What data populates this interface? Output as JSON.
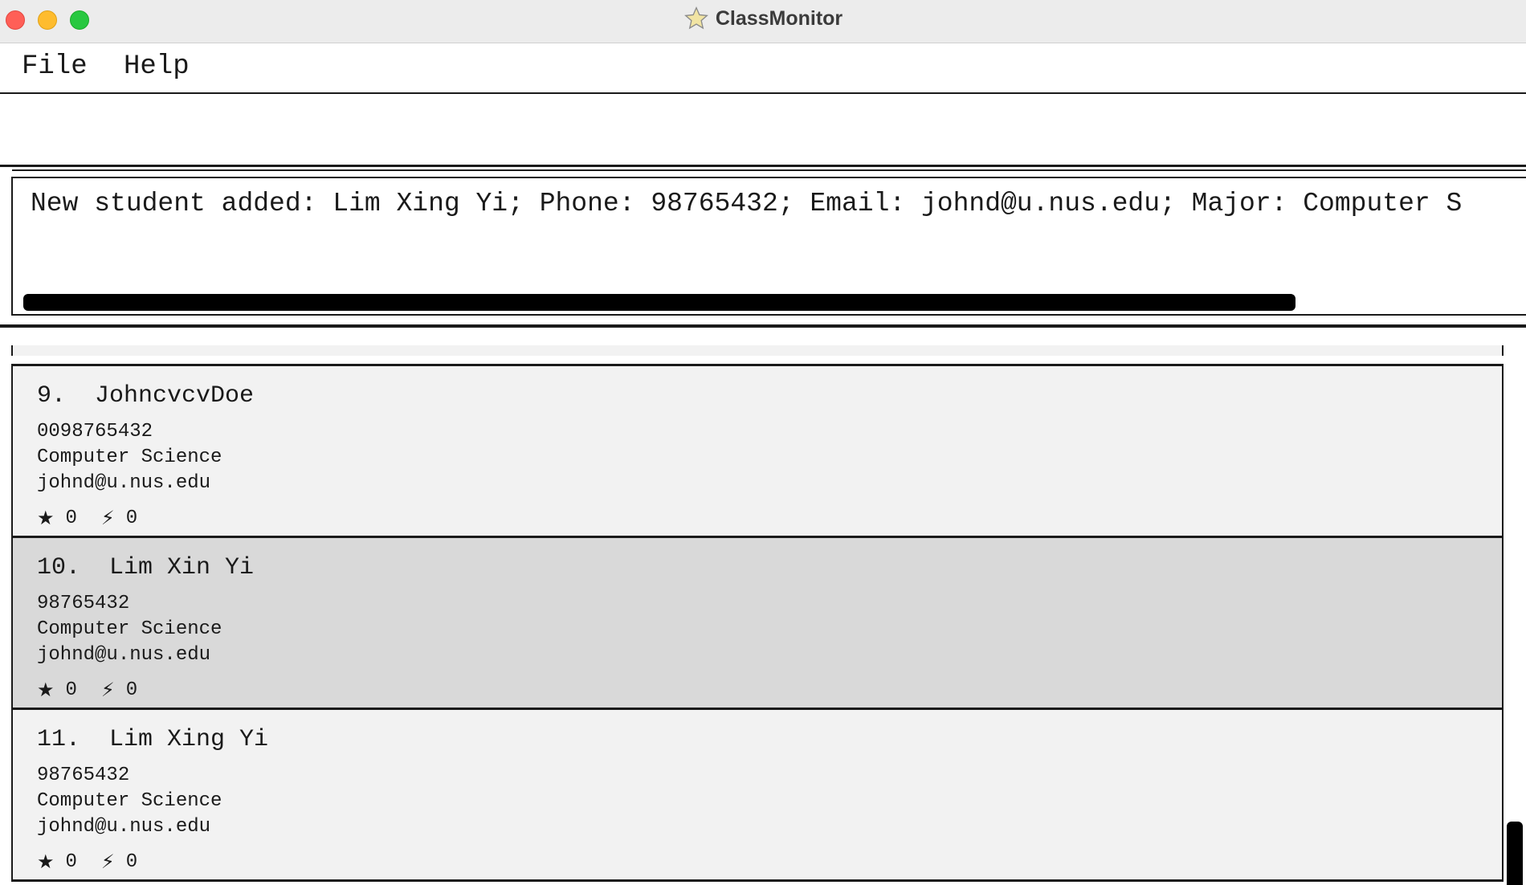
{
  "window": {
    "title": "ClassMonitor",
    "icon": "star-icon"
  },
  "menubar": {
    "items": [
      {
        "label": "File"
      },
      {
        "label": "Help"
      }
    ]
  },
  "command": {
    "value": "",
    "placeholder": ""
  },
  "result": {
    "text": "New student added: Lim Xing Yi; Phone: 98765432; Email: johnd@u.nus.edu; Major: Computer S"
  },
  "students": [
    {
      "name": "9.  JohncvcvDoe",
      "phone": "0098765432",
      "major": "Computer Science",
      "email": "johnd@u.nus.edu",
      "stars": "0",
      "energy": "0",
      "selected": false
    },
    {
      "name": "10.  Lim Xin Yi",
      "phone": "98765432",
      "major": "Computer Science",
      "email": "johnd@u.nus.edu",
      "stars": "0",
      "energy": "0",
      "selected": true
    },
    {
      "name": "11.  Lim Xing Yi",
      "phone": "98765432",
      "major": "Computer Science",
      "email": "johnd@u.nus.edu",
      "stars": "0",
      "energy": "0",
      "selected": false
    }
  ],
  "icons": {
    "star_glyph": "★",
    "energy_glyph": "⚡"
  },
  "colors": {
    "card_bg": "#f2f2f2",
    "card_selected_bg": "#d9d9d9",
    "close": "#ff5f57",
    "minimize": "#febc2e",
    "maximize": "#28c840"
  }
}
